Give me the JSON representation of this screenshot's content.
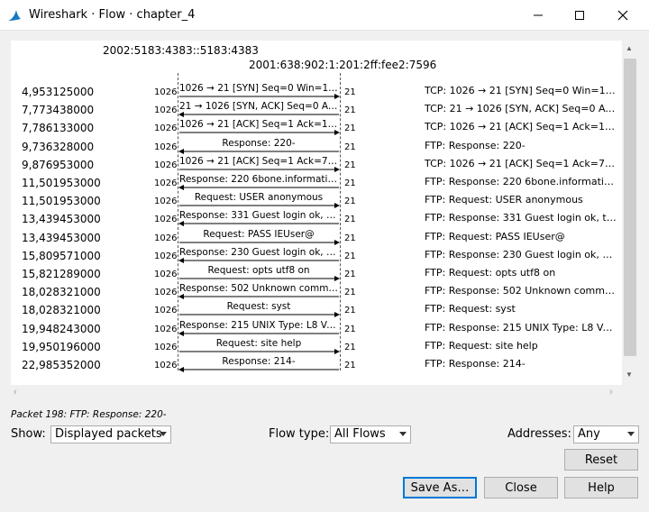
{
  "window": {
    "title": "Wireshark · Flow · chapter_4"
  },
  "flow": {
    "address_a": "2002:5183:4383::5183:4383",
    "address_b": "2001:638:902:1:201:2ff:fee2:7596",
    "rows": [
      {
        "time": "4,953125000",
        "port_a": "1026",
        "port_b": "21",
        "label": "1026 → 21 [SYN] Seq=0 Win=163…",
        "dir": "right",
        "comment": "TCP: 1026 → 21 [SYN] Seq=0 Win=1638…"
      },
      {
        "time": "7,773438000",
        "port_a": "1026",
        "port_b": "21",
        "label": "21 → 1026 [SYN, ACK] Seq=0 Ac…",
        "dir": "left",
        "comment": "TCP: 21 → 1026 [SYN, ACK] Seq=0 Ack…"
      },
      {
        "time": "7,786133000",
        "port_a": "1026",
        "port_b": "21",
        "label": "1026 → 21 [ACK] Seq=1 Ack=1 W…",
        "dir": "right",
        "comment": "TCP: 1026 → 21 [ACK] Seq=1 Ack=1 Wi…"
      },
      {
        "time": "9,736328000",
        "port_a": "1026",
        "port_b": "21",
        "label": "Response: 220-",
        "dir": "left",
        "comment": "FTP: Response: 220-"
      },
      {
        "time": "9,876953000",
        "port_a": "1026",
        "port_b": "21",
        "label": "1026 → 21 [ACK] Seq=1 Ack=7 W…",
        "dir": "right",
        "comment": "TCP: 1026 → 21 [ACK] Seq=1 Ack=7 Wi…"
      },
      {
        "time": "11,501953000",
        "port_a": "1026",
        "port_b": "21",
        "label": "Response: 220 6bone.informatik.…",
        "dir": "left",
        "comment": "FTP: Response: 220 6bone.informatik.u…"
      },
      {
        "time": "11,501953000",
        "port_a": "1026",
        "port_b": "21",
        "label": "Request: USER anonymous",
        "dir": "right",
        "comment": "FTP: Request: USER anonymous"
      },
      {
        "time": "13,439453000",
        "port_a": "1026",
        "port_b": "21",
        "label": "Response: 331 Guest login ok, ty…",
        "dir": "left",
        "comment": "FTP: Response: 331 Guest login ok, typ…"
      },
      {
        "time": "13,439453000",
        "port_a": "1026",
        "port_b": "21",
        "label": "Request: PASS IEUser@",
        "dir": "right",
        "comment": "FTP: Request: PASS IEUser@"
      },
      {
        "time": "15,809571000",
        "port_a": "1026",
        "port_b": "21",
        "label": "Response: 230 Guest login ok, a…",
        "dir": "left",
        "comment": "FTP: Response: 230 Guest login ok, acc…"
      },
      {
        "time": "15,821289000",
        "port_a": "1026",
        "port_b": "21",
        "label": "Request: opts utf8 on",
        "dir": "right",
        "comment": "FTP: Request: opts utf8 on"
      },
      {
        "time": "18,028321000",
        "port_a": "1026",
        "port_b": "21",
        "label": "Response: 502 Unknown comma…",
        "dir": "left",
        "comment": "FTP: Response: 502 Unknown comman…"
      },
      {
        "time": "18,028321000",
        "port_a": "1026",
        "port_b": "21",
        "label": "Request: syst",
        "dir": "right",
        "comment": "FTP: Request: syst"
      },
      {
        "time": "19,948243000",
        "port_a": "1026",
        "port_b": "21",
        "label": "Response: 215 UNIX Type: L8 Ve…",
        "dir": "left",
        "comment": "FTP: Response: 215 UNIX Type: L8 Ver…"
      },
      {
        "time": "19,950196000",
        "port_a": "1026",
        "port_b": "21",
        "label": "Request: site help",
        "dir": "right",
        "comment": "FTP: Request: site help"
      },
      {
        "time": "22,985352000",
        "port_a": "1026",
        "port_b": "21",
        "label": "Response: 214-",
        "dir": "left",
        "comment": "FTP: Response: 214-"
      }
    ]
  },
  "status": {
    "text": "Packet 198: FTP: Response: 220-"
  },
  "controls": {
    "show_label": "Show:",
    "show_value": "Displayed packets",
    "flow_type_label": "Flow type:",
    "flow_type_value": "All Flows",
    "addresses_label": "Addresses:",
    "addresses_value": "Any",
    "reset_label": "Reset",
    "save_as_label": "Save As…",
    "close_label": "Close",
    "help_label": "Help"
  }
}
